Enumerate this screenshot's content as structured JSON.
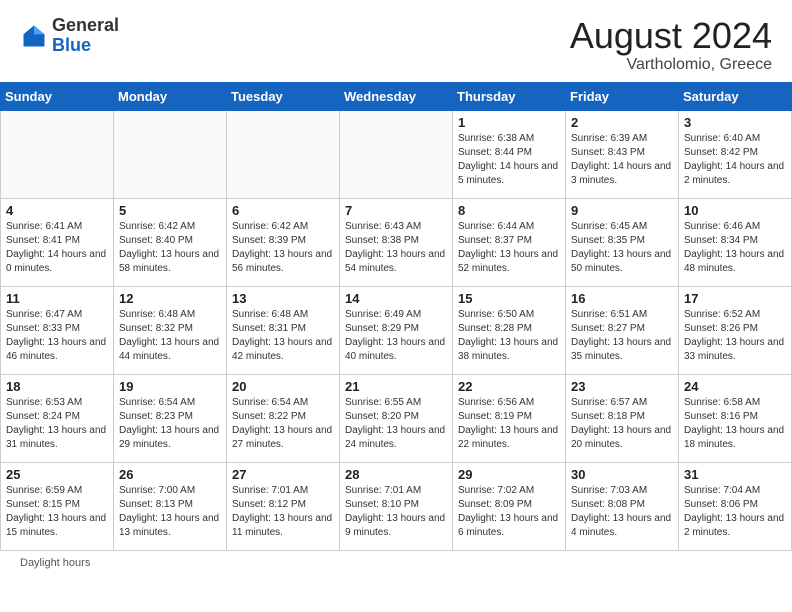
{
  "header": {
    "logo_general": "General",
    "logo_blue": "Blue",
    "month_year": "August 2024",
    "location": "Vartholomio, Greece"
  },
  "days_of_week": [
    "Sunday",
    "Monday",
    "Tuesday",
    "Wednesday",
    "Thursday",
    "Friday",
    "Saturday"
  ],
  "footer": {
    "daylight_hours": "Daylight hours"
  },
  "weeks": [
    {
      "days": [
        {
          "num": "",
          "sunrise": "",
          "sunset": "",
          "daylight": "",
          "empty": true
        },
        {
          "num": "",
          "sunrise": "",
          "sunset": "",
          "daylight": "",
          "empty": true
        },
        {
          "num": "",
          "sunrise": "",
          "sunset": "",
          "daylight": "",
          "empty": true
        },
        {
          "num": "",
          "sunrise": "",
          "sunset": "",
          "daylight": "",
          "empty": true
        },
        {
          "num": "1",
          "sunrise": "Sunrise: 6:38 AM",
          "sunset": "Sunset: 8:44 PM",
          "daylight": "Daylight: 14 hours and 5 minutes.",
          "empty": false
        },
        {
          "num": "2",
          "sunrise": "Sunrise: 6:39 AM",
          "sunset": "Sunset: 8:43 PM",
          "daylight": "Daylight: 14 hours and 3 minutes.",
          "empty": false
        },
        {
          "num": "3",
          "sunrise": "Sunrise: 6:40 AM",
          "sunset": "Sunset: 8:42 PM",
          "daylight": "Daylight: 14 hours and 2 minutes.",
          "empty": false
        }
      ]
    },
    {
      "days": [
        {
          "num": "4",
          "sunrise": "Sunrise: 6:41 AM",
          "sunset": "Sunset: 8:41 PM",
          "daylight": "Daylight: 14 hours and 0 minutes.",
          "empty": false
        },
        {
          "num": "5",
          "sunrise": "Sunrise: 6:42 AM",
          "sunset": "Sunset: 8:40 PM",
          "daylight": "Daylight: 13 hours and 58 minutes.",
          "empty": false
        },
        {
          "num": "6",
          "sunrise": "Sunrise: 6:42 AM",
          "sunset": "Sunset: 8:39 PM",
          "daylight": "Daylight: 13 hours and 56 minutes.",
          "empty": false
        },
        {
          "num": "7",
          "sunrise": "Sunrise: 6:43 AM",
          "sunset": "Sunset: 8:38 PM",
          "daylight": "Daylight: 13 hours and 54 minutes.",
          "empty": false
        },
        {
          "num": "8",
          "sunrise": "Sunrise: 6:44 AM",
          "sunset": "Sunset: 8:37 PM",
          "daylight": "Daylight: 13 hours and 52 minutes.",
          "empty": false
        },
        {
          "num": "9",
          "sunrise": "Sunrise: 6:45 AM",
          "sunset": "Sunset: 8:35 PM",
          "daylight": "Daylight: 13 hours and 50 minutes.",
          "empty": false
        },
        {
          "num": "10",
          "sunrise": "Sunrise: 6:46 AM",
          "sunset": "Sunset: 8:34 PM",
          "daylight": "Daylight: 13 hours and 48 minutes.",
          "empty": false
        }
      ]
    },
    {
      "days": [
        {
          "num": "11",
          "sunrise": "Sunrise: 6:47 AM",
          "sunset": "Sunset: 8:33 PM",
          "daylight": "Daylight: 13 hours and 46 minutes.",
          "empty": false
        },
        {
          "num": "12",
          "sunrise": "Sunrise: 6:48 AM",
          "sunset": "Sunset: 8:32 PM",
          "daylight": "Daylight: 13 hours and 44 minutes.",
          "empty": false
        },
        {
          "num": "13",
          "sunrise": "Sunrise: 6:48 AM",
          "sunset": "Sunset: 8:31 PM",
          "daylight": "Daylight: 13 hours and 42 minutes.",
          "empty": false
        },
        {
          "num": "14",
          "sunrise": "Sunrise: 6:49 AM",
          "sunset": "Sunset: 8:29 PM",
          "daylight": "Daylight: 13 hours and 40 minutes.",
          "empty": false
        },
        {
          "num": "15",
          "sunrise": "Sunrise: 6:50 AM",
          "sunset": "Sunset: 8:28 PM",
          "daylight": "Daylight: 13 hours and 38 minutes.",
          "empty": false
        },
        {
          "num": "16",
          "sunrise": "Sunrise: 6:51 AM",
          "sunset": "Sunset: 8:27 PM",
          "daylight": "Daylight: 13 hours and 35 minutes.",
          "empty": false
        },
        {
          "num": "17",
          "sunrise": "Sunrise: 6:52 AM",
          "sunset": "Sunset: 8:26 PM",
          "daylight": "Daylight: 13 hours and 33 minutes.",
          "empty": false
        }
      ]
    },
    {
      "days": [
        {
          "num": "18",
          "sunrise": "Sunrise: 6:53 AM",
          "sunset": "Sunset: 8:24 PM",
          "daylight": "Daylight: 13 hours and 31 minutes.",
          "empty": false
        },
        {
          "num": "19",
          "sunrise": "Sunrise: 6:54 AM",
          "sunset": "Sunset: 8:23 PM",
          "daylight": "Daylight: 13 hours and 29 minutes.",
          "empty": false
        },
        {
          "num": "20",
          "sunrise": "Sunrise: 6:54 AM",
          "sunset": "Sunset: 8:22 PM",
          "daylight": "Daylight: 13 hours and 27 minutes.",
          "empty": false
        },
        {
          "num": "21",
          "sunrise": "Sunrise: 6:55 AM",
          "sunset": "Sunset: 8:20 PM",
          "daylight": "Daylight: 13 hours and 24 minutes.",
          "empty": false
        },
        {
          "num": "22",
          "sunrise": "Sunrise: 6:56 AM",
          "sunset": "Sunset: 8:19 PM",
          "daylight": "Daylight: 13 hours and 22 minutes.",
          "empty": false
        },
        {
          "num": "23",
          "sunrise": "Sunrise: 6:57 AM",
          "sunset": "Sunset: 8:18 PM",
          "daylight": "Daylight: 13 hours and 20 minutes.",
          "empty": false
        },
        {
          "num": "24",
          "sunrise": "Sunrise: 6:58 AM",
          "sunset": "Sunset: 8:16 PM",
          "daylight": "Daylight: 13 hours and 18 minutes.",
          "empty": false
        }
      ]
    },
    {
      "days": [
        {
          "num": "25",
          "sunrise": "Sunrise: 6:59 AM",
          "sunset": "Sunset: 8:15 PM",
          "daylight": "Daylight: 13 hours and 15 minutes.",
          "empty": false
        },
        {
          "num": "26",
          "sunrise": "Sunrise: 7:00 AM",
          "sunset": "Sunset: 8:13 PM",
          "daylight": "Daylight: 13 hours and 13 minutes.",
          "empty": false
        },
        {
          "num": "27",
          "sunrise": "Sunrise: 7:01 AM",
          "sunset": "Sunset: 8:12 PM",
          "daylight": "Daylight: 13 hours and 11 minutes.",
          "empty": false
        },
        {
          "num": "28",
          "sunrise": "Sunrise: 7:01 AM",
          "sunset": "Sunset: 8:10 PM",
          "daylight": "Daylight: 13 hours and 9 minutes.",
          "empty": false
        },
        {
          "num": "29",
          "sunrise": "Sunrise: 7:02 AM",
          "sunset": "Sunset: 8:09 PM",
          "daylight": "Daylight: 13 hours and 6 minutes.",
          "empty": false
        },
        {
          "num": "30",
          "sunrise": "Sunrise: 7:03 AM",
          "sunset": "Sunset: 8:08 PM",
          "daylight": "Daylight: 13 hours and 4 minutes.",
          "empty": false
        },
        {
          "num": "31",
          "sunrise": "Sunrise: 7:04 AM",
          "sunset": "Sunset: 8:06 PM",
          "daylight": "Daylight: 13 hours and 2 minutes.",
          "empty": false
        }
      ]
    }
  ]
}
